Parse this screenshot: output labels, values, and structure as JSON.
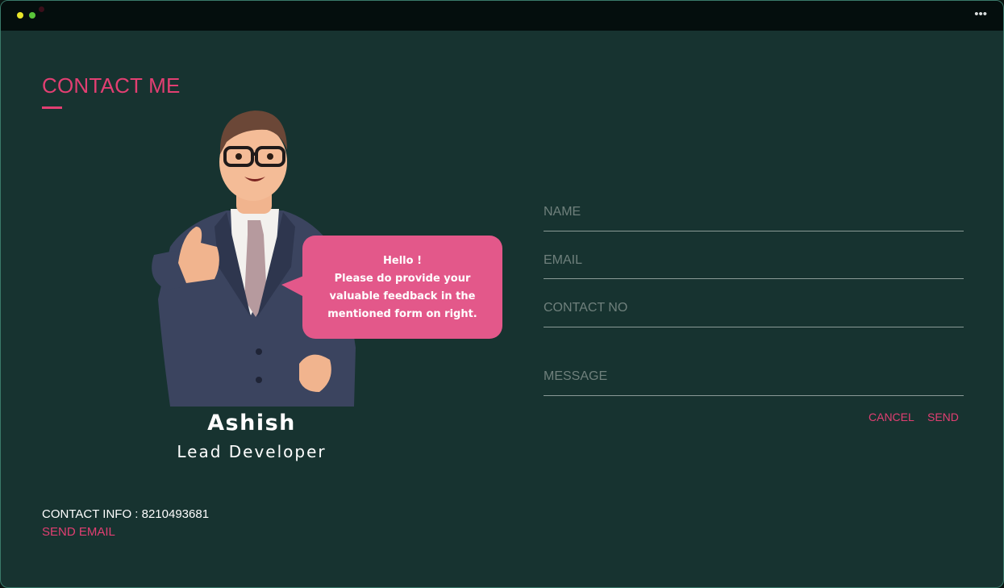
{
  "window": {
    "more_icon": "ellipsis-icon"
  },
  "page": {
    "title": "CONTACT ME",
    "accent_color": "#e23f72"
  },
  "bubble": {
    "greeting": "Hello !",
    "line1": "Please do provide your",
    "line2": "valuable feedback in the",
    "line3": "mentioned form on right.",
    "color": "#e3588a"
  },
  "profile": {
    "name": "Ashish",
    "role": "Lead Developer"
  },
  "contact": {
    "info": "CONTACT INFO : 8210493681",
    "send_email": "SEND EMAIL"
  },
  "form": {
    "name_placeholder": "NAME",
    "email_placeholder": "EMAIL",
    "contact_placeholder": "CONTACT NO",
    "message_placeholder": "MESSAGE",
    "cancel_label": "CANCEL",
    "send_label": "SEND"
  }
}
